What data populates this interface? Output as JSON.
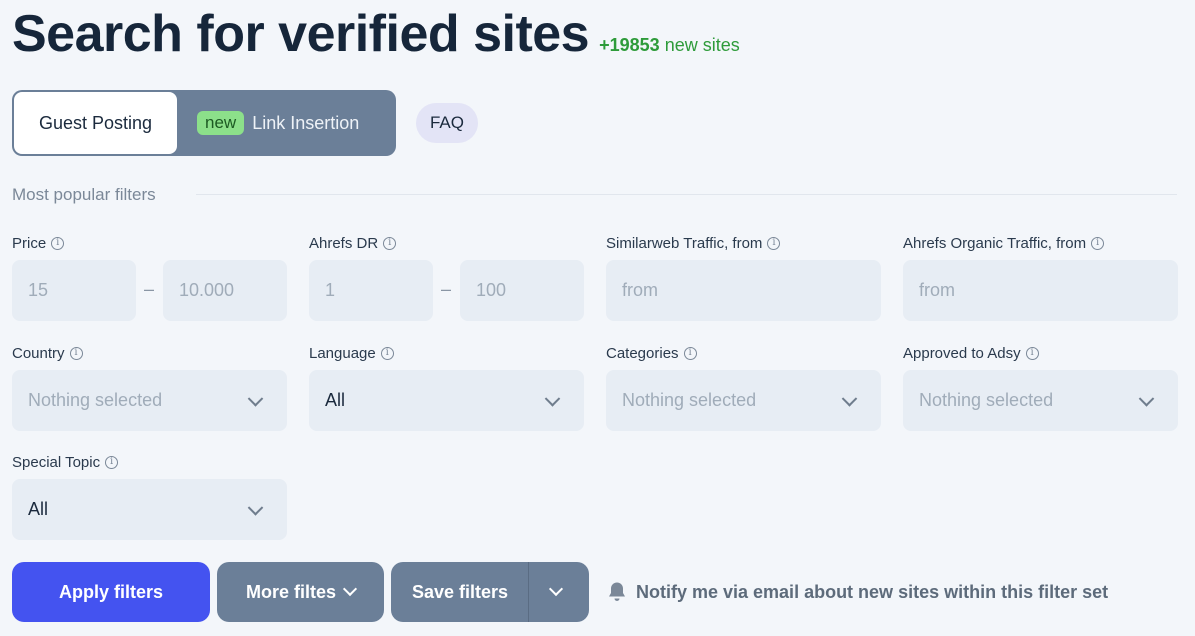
{
  "header": {
    "title": "Search for verified sites",
    "new_sites_count": "+19853",
    "new_sites_label": "new sites"
  },
  "mode_switch": {
    "guest_posting": "Guest Posting",
    "new_badge": "new",
    "link_insertion": "Link Insertion",
    "selected": "Guest Posting"
  },
  "faq_label": "FAQ",
  "section_label": "Most popular filters",
  "filters": {
    "price": {
      "label": "Price",
      "from": "15",
      "to": "10.000"
    },
    "ahrefs_dr": {
      "label": "Ahrefs DR",
      "from": "1",
      "to": "100"
    },
    "similarweb": {
      "label": "Similarweb Traffic, from",
      "placeholder": "from"
    },
    "ahrefs_organic": {
      "label": "Ahrefs Organic Traffic, from",
      "placeholder": "from"
    },
    "country": {
      "label": "Country",
      "value": "Nothing selected"
    },
    "language": {
      "label": "Language",
      "value": "All"
    },
    "categories": {
      "label": "Categories",
      "value": "Nothing selected"
    },
    "approved": {
      "label": "Approved to Adsy",
      "value": "Nothing selected"
    },
    "special_topic": {
      "label": "Special Topic",
      "value": "All"
    },
    "range_separator": "–"
  },
  "actions": {
    "apply": "Apply filters",
    "more": "More filtes",
    "save": "Save filters",
    "notify": "Notify me via email about new sites within this filter set"
  },
  "icons": {
    "info": "info-icon",
    "chevron": "chevron-down-icon",
    "bell": "bell-icon"
  },
  "colors": {
    "accent": "#4453f0",
    "secondary_button": "#6b7f98",
    "new_sites_green": "#2e9b3a",
    "new_badge_bg": "#8ce08a"
  }
}
